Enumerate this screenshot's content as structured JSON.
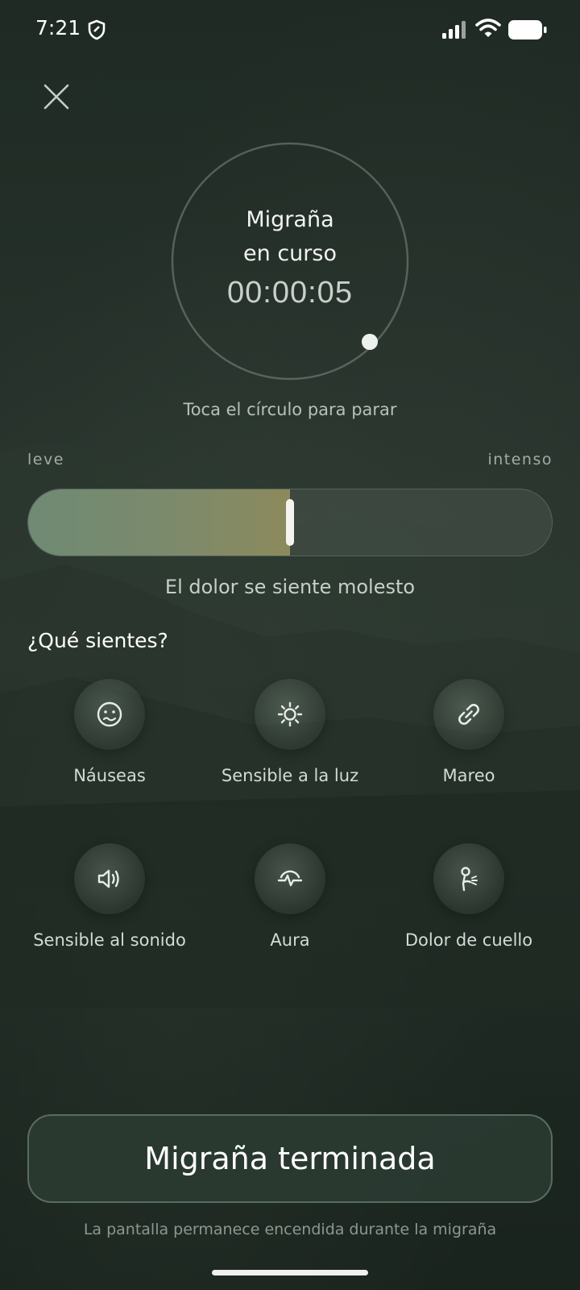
{
  "status_bar": {
    "time": "7:21",
    "icons": [
      "shield-icon",
      "signal-icon",
      "wifi-icon",
      "battery-icon"
    ]
  },
  "close_icon": "close-icon",
  "timer": {
    "title_line1": "Migraña",
    "title_line2": "en curso",
    "elapsed": "00:00:05",
    "hint": "Toca el círculo para parar"
  },
  "pain_scale": {
    "low_label": "leve",
    "high_label": "intenso",
    "level_fraction": 0.5,
    "description": "El dolor se siente molesto"
  },
  "symptoms": {
    "title": "¿Qué sientes?",
    "items": [
      {
        "label": "Náuseas",
        "icon": "nausea-face-icon"
      },
      {
        "label": "Sensible a la luz",
        "icon": "sun-icon"
      },
      {
        "label": "Mareo",
        "icon": "link-icon"
      },
      {
        "label": "Sensible al sonido",
        "icon": "speaker-icon"
      },
      {
        "label": "Aura",
        "icon": "pulse-wave-icon"
      },
      {
        "label": "Dolor de cuello",
        "icon": "neck-person-icon"
      }
    ]
  },
  "finish_button": {
    "label": "Migraña terminada"
  },
  "footer": {
    "note": "La pantalla permanece encendida durante la migraña"
  },
  "colors": {
    "background": "#25312a",
    "slider_fill_start": "#6f8a74",
    "slider_fill_end": "#8c8a5c",
    "accent_white": "#f4f4ee"
  }
}
